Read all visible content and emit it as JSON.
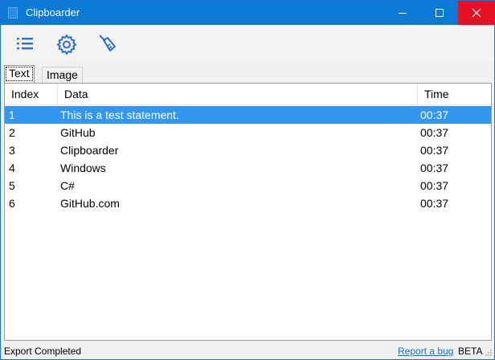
{
  "window": {
    "title": "Clipboarder",
    "accent_color": "#0a7ad6",
    "close_color": "#e81123"
  },
  "toolbar": {
    "icons": [
      "list-icon",
      "settings-gear-icon",
      "clear-broom-icon"
    ]
  },
  "tabs": [
    {
      "label": "Text",
      "active": true
    },
    {
      "label": "Image",
      "active": false
    }
  ],
  "list": {
    "columns": [
      "Index",
      "Data",
      "Time"
    ],
    "selected_color": "#3397f0",
    "rows": [
      {
        "index": "1",
        "data": "This is a test statement.",
        "time": "00:37",
        "selected": true
      },
      {
        "index": "2",
        "data": "GitHub",
        "time": "00:37",
        "selected": false
      },
      {
        "index": "3",
        "data": "Clipboarder",
        "time": "00:37",
        "selected": false
      },
      {
        "index": "4",
        "data": "Windows",
        "time": "00:37",
        "selected": false
      },
      {
        "index": "5",
        "data": "C#",
        "time": "00:37",
        "selected": false
      },
      {
        "index": "6",
        "data": "GitHub.com",
        "time": "00:37",
        "selected": false
      }
    ]
  },
  "status": {
    "message": "Export Completed",
    "report_link": "Report a bug",
    "version_tag": "BETA"
  }
}
